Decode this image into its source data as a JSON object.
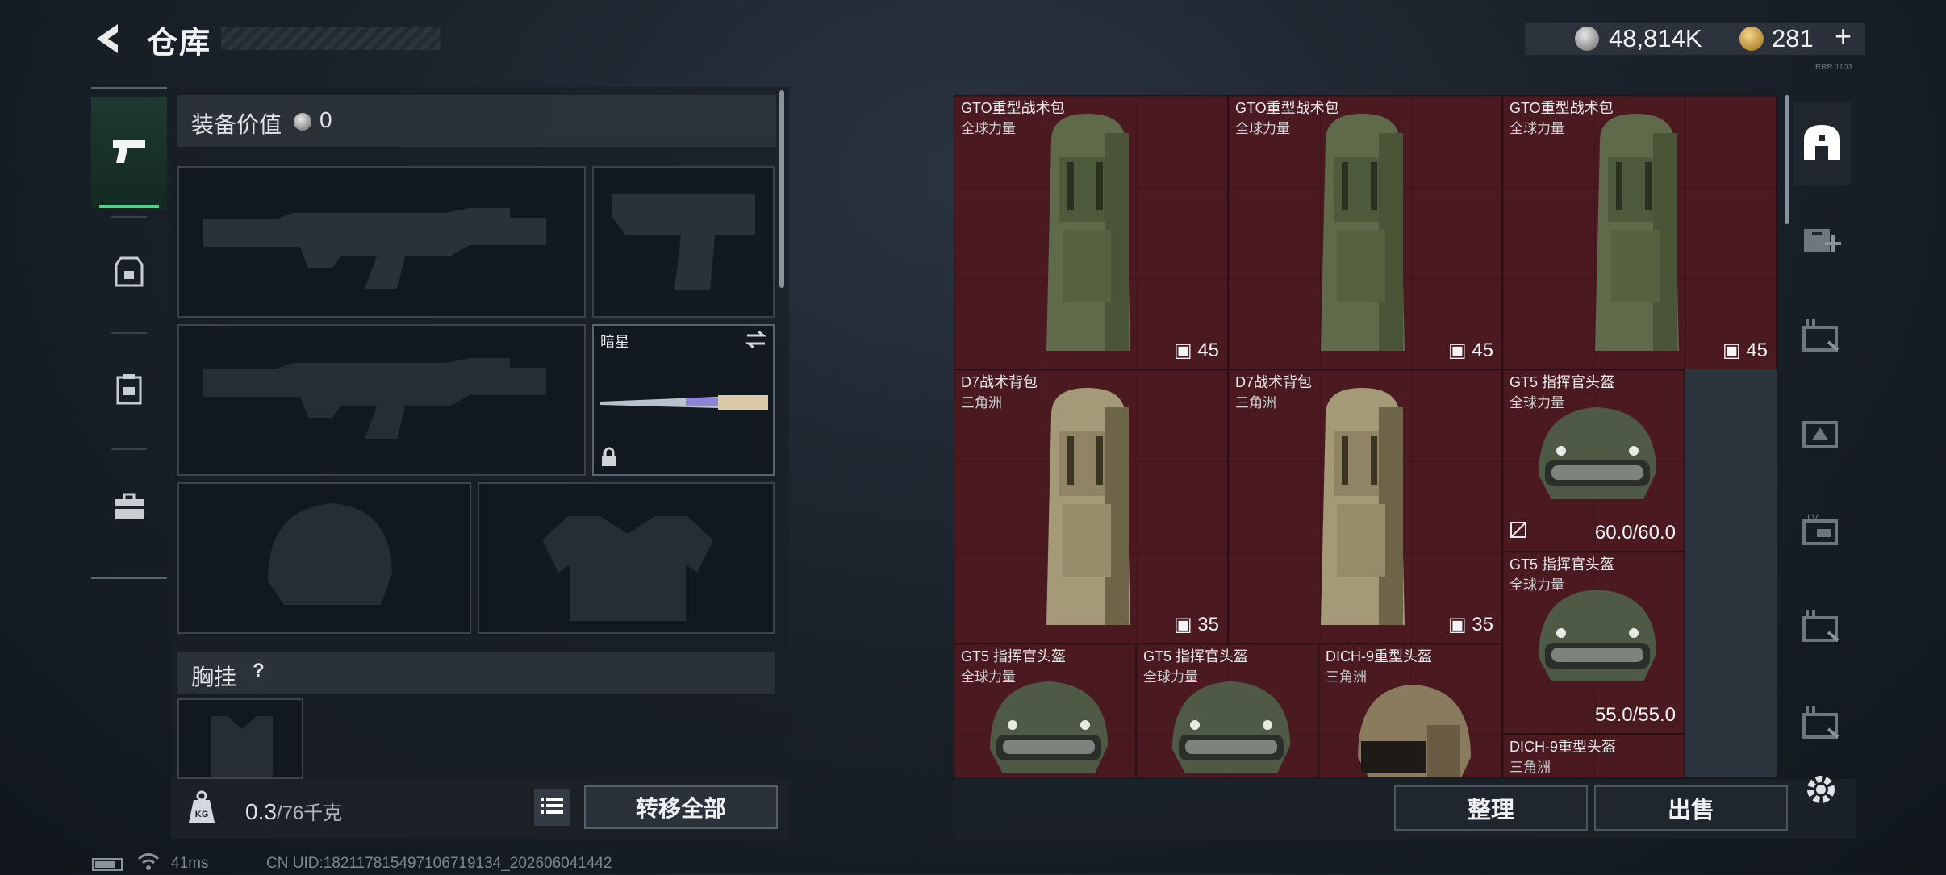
{
  "header": {
    "title": "仓库"
  },
  "currency": {
    "silver": "48,814K",
    "gold": "281",
    "plus": "+"
  },
  "version_tag": "RRR 1103",
  "equipment": {
    "value_label": "装备价值",
    "value": "0",
    "knife_name": "暗星",
    "chest_label": "胸挂",
    "chest_help": "?"
  },
  "footer_left": {
    "weight": "0.3",
    "weight_max": "/76千克",
    "transfer_all": "转移全部"
  },
  "footer_right": {
    "sort": "整理",
    "sell": "出售"
  },
  "storage": [
    {
      "name": "GTO重型战术包",
      "sub": "全球力量",
      "count": "45"
    },
    {
      "name": "GTO重型战术包",
      "sub": "全球力量",
      "count": "45"
    },
    {
      "name": "GTO重型战术包",
      "sub": "全球力量",
      "count": "45"
    },
    {
      "name": "D7战术背包",
      "sub": "三角洲",
      "count": "35"
    },
    {
      "name": "D7战术背包",
      "sub": "三角洲",
      "count": "35"
    },
    {
      "name": "GT5 指挥官头盔",
      "sub": "全球力量",
      "durability": "60.0/60.0"
    },
    {
      "name": "GT5 指挥官头盔",
      "sub": "全球力量",
      "durability": "55.0/55.0"
    },
    {
      "name": "GT5 指挥官头盔",
      "sub": "全球力量"
    },
    {
      "name": "GT5 指挥官头盔",
      "sub": "全球力量"
    },
    {
      "name": "DICH-9重型头盔",
      "sub": "三角洲"
    },
    {
      "name": "DICH-9重型头盔",
      "sub": "三角洲"
    }
  ],
  "status": {
    "ping": "41ms",
    "uid": "CN UID:182117815497106719134_202606041442"
  },
  "colors": {
    "accent_green": "#4fd18a",
    "grid_cell": "#4a1a20"
  }
}
